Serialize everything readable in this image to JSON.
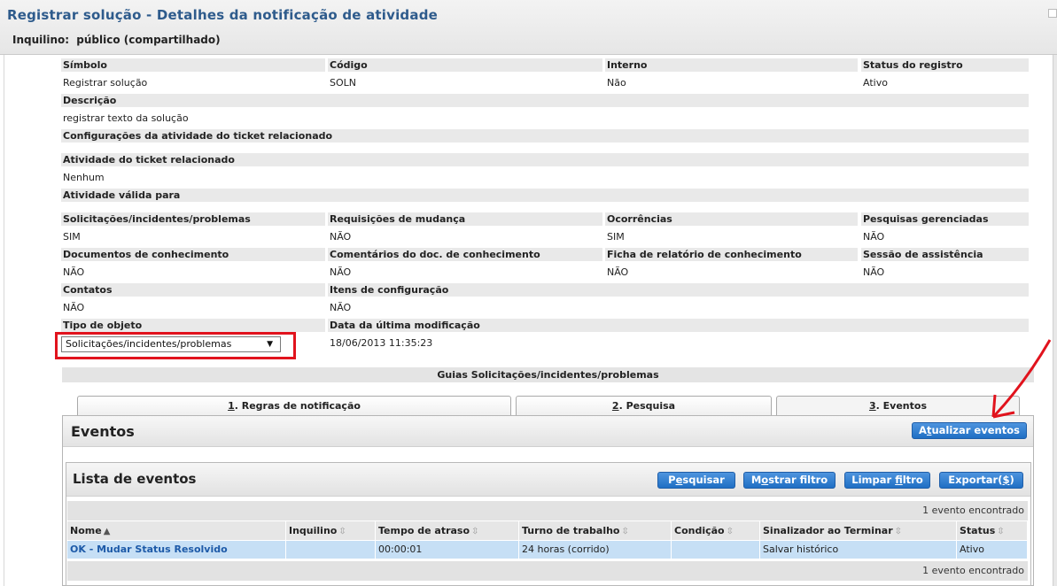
{
  "window": {
    "title": "Registrar solução - Detalhes da notificação de atividade",
    "tenant_label": "Inquilino:",
    "tenant_value": "público (compartilhado)"
  },
  "details": {
    "symbol": {
      "label": "Símbolo",
      "value": "Registrar solução"
    },
    "code": {
      "label": "Código",
      "value": "SOLN"
    },
    "internal": {
      "label": "Interno",
      "value": "Não"
    },
    "status": {
      "label": "Status do registro",
      "value": "Ativo"
    },
    "description": {
      "label": "Descrição",
      "value": "registrar texto da solução"
    },
    "ticket_settings_label": "Configurações da atividade do ticket relacionado",
    "related_activity": {
      "label": "Atividade do ticket relacionado",
      "value": "Nenhum"
    },
    "valid_for_label": "Atividade válida para",
    "incidents": {
      "label": "Solicitações/incidentes/problemas",
      "value": "SIM"
    },
    "change_requests": {
      "label": "Requisições de mudança",
      "value": "NÃO"
    },
    "occurrences": {
      "label": "Ocorrências",
      "value": "SIM"
    },
    "surveys": {
      "label": "Pesquisas gerenciadas",
      "value": "NÃO"
    },
    "knowledge_docs": {
      "label": "Documentos de conhecimento",
      "value": "NÃO"
    },
    "knowledge_comments": {
      "label": "Comentários do doc. de conhecimento",
      "value": "NÃO"
    },
    "knowledge_report": {
      "label": "Ficha de relatório de conhecimento",
      "value": "NÃO"
    },
    "assist_session": {
      "label": "Sessão de assistência",
      "value": "NÃO"
    },
    "contacts": {
      "label": "Contatos",
      "value": "NÃO"
    },
    "config_items": {
      "label": "Itens de configuração",
      "value": "NÃO"
    },
    "object_type": {
      "label": "Tipo de objeto",
      "selected": "Solicitações/incidentes/problemas"
    },
    "last_modified": {
      "label": "Data da última modificação",
      "value": "18/06/2013 11:35:23"
    }
  },
  "guias_title": "Guias Solicitações/incidentes/problemas",
  "tabs": [
    {
      "num": "1",
      "rest": ". Regras de notificação"
    },
    {
      "num": "2",
      "rest": ". Pesquisa"
    },
    {
      "num": "3",
      "rest": ". Eventos"
    }
  ],
  "events_panel": {
    "title": "Eventos",
    "refresh_button": {
      "prefix": "A",
      "ul": "t",
      "suffix": "ualizar eventos"
    }
  },
  "event_list": {
    "title": "Lista de eventos",
    "buttons": {
      "search": {
        "prefix": "P",
        "ul": "e",
        "suffix": "squisar"
      },
      "show_filter": {
        "prefix": "M",
        "ul": "o",
        "suffix": "strar filtro"
      },
      "clear_filter": {
        "prefix": "Limpar ",
        "ul": "f",
        "suffix": "iltro"
      },
      "export": {
        "prefix": "Exportar(",
        "ul": "$",
        "suffix": ")"
      }
    },
    "count_text": "1 evento encontrado",
    "columns": [
      "Nome",
      "Inquilino",
      "Tempo de atraso",
      "Turno de trabalho",
      "Condição",
      "Sinalizador ao Terminar",
      "Status"
    ],
    "rows": [
      {
        "name": "OK - Mudar Status Resolvido",
        "tenant": "",
        "delay": "00:00:01",
        "shift": "24 horas (corrido)",
        "condition": "",
        "flag": "Salvar histórico",
        "status": "Ativo"
      }
    ]
  },
  "annotation_color": "#e1131d"
}
